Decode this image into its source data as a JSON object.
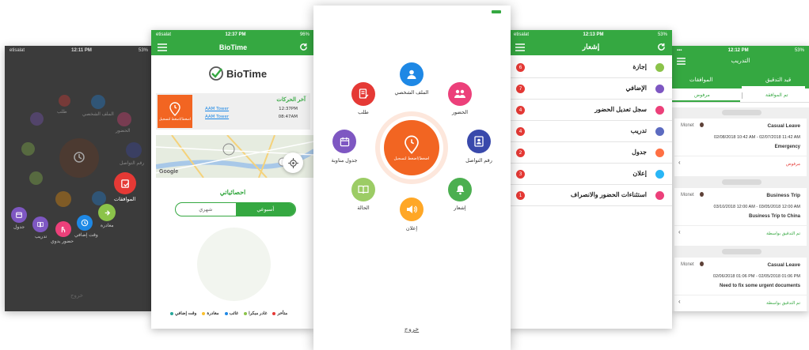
{
  "p1": {
    "status": {
      "carrier": "etisalat",
      "time": "12:11 PM",
      "battery": "53%"
    },
    "menu": {
      "approvals": "الموافقات",
      "leave": "مغادرة",
      "overtime": "وقت إضافي",
      "manual_attendance": "حضور يدوي",
      "training": "تدريب",
      "schedule": "جدول",
      "profile": "الملف الشخصي",
      "attendance": "الحضور",
      "request": "طلب",
      "contact": "رقم التواصل",
      "shift_schedule": "جدول مناوبة",
      "status": "الحالة"
    },
    "bottom": "خروج"
  },
  "p2": {
    "status": {
      "carrier": "etisalat",
      "time": "12:37 PM",
      "battery": "96%"
    },
    "title": "BioTime",
    "logo_text": "BioTime",
    "punch_button": "اضغط/اضغط لتسجيل",
    "last_moves_title": "آخر الحركات",
    "moves": [
      {
        "time": "12:37PM",
        "place": "AAM Tower"
      },
      {
        "time": "08:47AM",
        "place": "AAM Tower"
      }
    ],
    "map_brand": "Google",
    "stats_title": "احصائياتي",
    "tabs": {
      "weekly": "أسبوعي",
      "monthly": "شهري"
    },
    "legend": [
      {
        "label": "متأخر",
        "color": "#e53935"
      },
      {
        "label": "غادر مبكرا",
        "color": "#8bc34a"
      },
      {
        "label": "غائب",
        "color": "#1e88e5"
      },
      {
        "label": "مغادرة",
        "color": "#fbc02d"
      },
      {
        "label": "وقت إضافي",
        "color": "#26a69a"
      }
    ]
  },
  "p3": {
    "center": "اضغط/اضغط لتسجيل",
    "items": {
      "profile": "الملف الشخصي",
      "attendance": "الحضور",
      "request": "طلب",
      "contact": "رقم التواصل",
      "shift_schedule": "جدول مناوبة",
      "notice": "إشعار",
      "status": "الحالة",
      "announcement": "إعلان"
    },
    "logout": "خروج"
  },
  "p4": {
    "status": {
      "carrier": "etisalat",
      "time": "12:13 PM",
      "battery": "53%"
    },
    "title": "إشعار",
    "items": [
      {
        "label": "إجازة",
        "count": "6",
        "color": "#8bc34a"
      },
      {
        "label": "الإضافي",
        "count": "7",
        "color": "#7e57c2"
      },
      {
        "label": "سجل تعديل الحضور",
        "count": "4",
        "color": "#ec407a"
      },
      {
        "label": "تدريب",
        "count": "4",
        "color": "#5c6bc0"
      },
      {
        "label": "جدول",
        "count": "2",
        "color": "#ff7043"
      },
      {
        "label": "إعلان",
        "count": "3",
        "color": "#29b6f6"
      },
      {
        "label": "استثناءات الحضور والانصراف",
        "count": "1",
        "color": "#ec407a"
      }
    ]
  },
  "p5": {
    "status": {
      "time": "12:12 PM",
      "battery": "53%"
    },
    "title": "التدريب",
    "tabs": {
      "pending": "قيد التدقيق",
      "approvals": "الموافقات"
    },
    "subtabs": {
      "approved": "تم الموافقة",
      "rejected": "مرفوض"
    },
    "cards": [
      {
        "type": "Casual Leave",
        "user": "Monet",
        "range": "02/08/2018 10:42 AM - 02/07/2018 11:42 AM",
        "note": "Emergency",
        "status": "مرفوض",
        "status_color": "#e53935"
      },
      {
        "type": "Business Trip",
        "user": "Monet",
        "range": "03/10/2018 12:00 AM - 03/05/2018 12:00 AM",
        "note": "Business Trip to China",
        "status": "تم التدقيق بواسطة",
        "status_color": "#35a841"
      },
      {
        "type": "Casual Leave",
        "user": "Monet",
        "range": "02/06/2018 01:06 PM - 02/05/2018 01:06 PM",
        "note": "Need to fix some urgent documents",
        "status": "تم التدقيق بواسطة",
        "status_color": "#35a841"
      }
    ]
  }
}
